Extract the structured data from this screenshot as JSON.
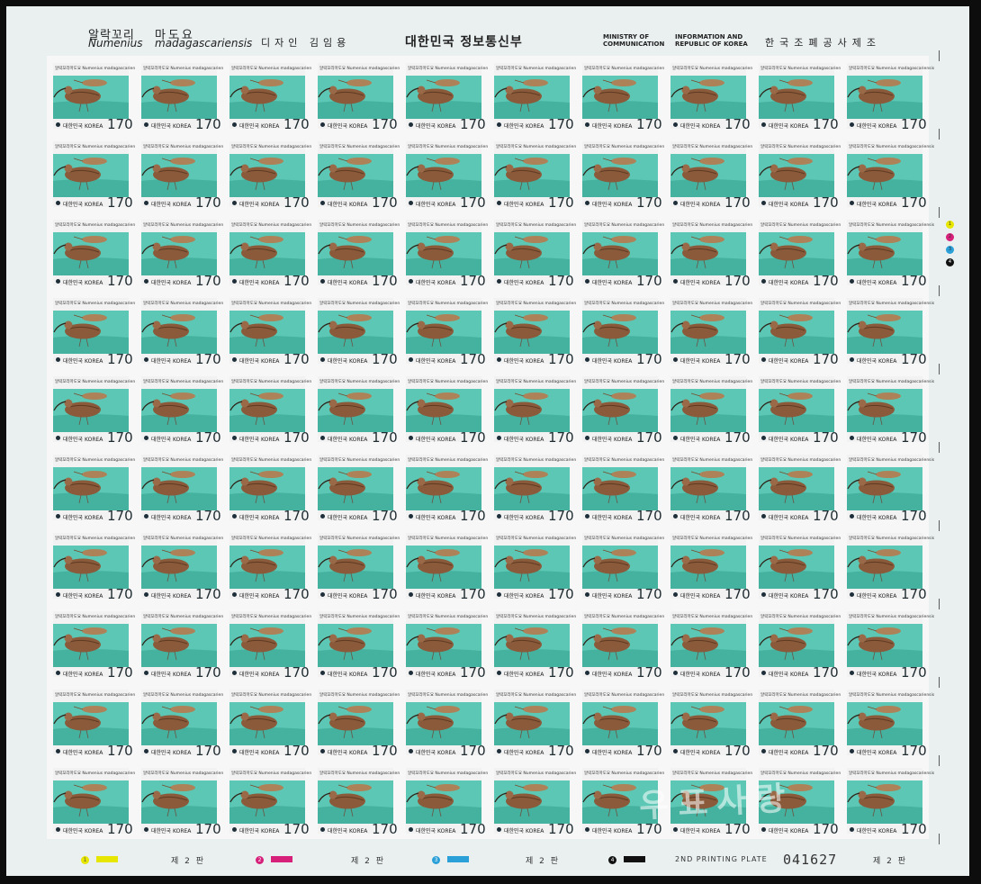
{
  "header": {
    "korean_name": "알락꼬리",
    "genus": "Numenius",
    "korean_name2": "마도요",
    "species": "madagascariensis",
    "designer": "디자인 김임용",
    "country": "대한민국 정보통신부",
    "ministry_line1": "MINISTRY OF",
    "ministry_line2": "COMMUNICATION",
    "info_line1": "INFORMATION AND",
    "info_line2": "REPUBLIC OF KOREA",
    "printer": "한국조폐공사제조"
  },
  "stamp": {
    "label": "알락꼬리마도요 Numenius madagascariensis",
    "country": "대한민국 KOREA",
    "value": "170",
    "rows": 10,
    "cols": 10
  },
  "registration_dots": [
    "1",
    "2",
    "3",
    "4"
  ],
  "footer": {
    "color_numbers": [
      "1",
      "2",
      "3",
      "4"
    ],
    "plate_label": "제 2 판",
    "plate_label_en": "2ND PRINTING PLATE",
    "serial": "041627"
  },
  "watermark": "우표사랑",
  "colors": {
    "sea": "#53c0ae",
    "bird": "#8a5a3a",
    "yellow": "#e6e600",
    "magenta": "#d6207a",
    "cyan": "#2a9fd8",
    "black": "#111111"
  }
}
